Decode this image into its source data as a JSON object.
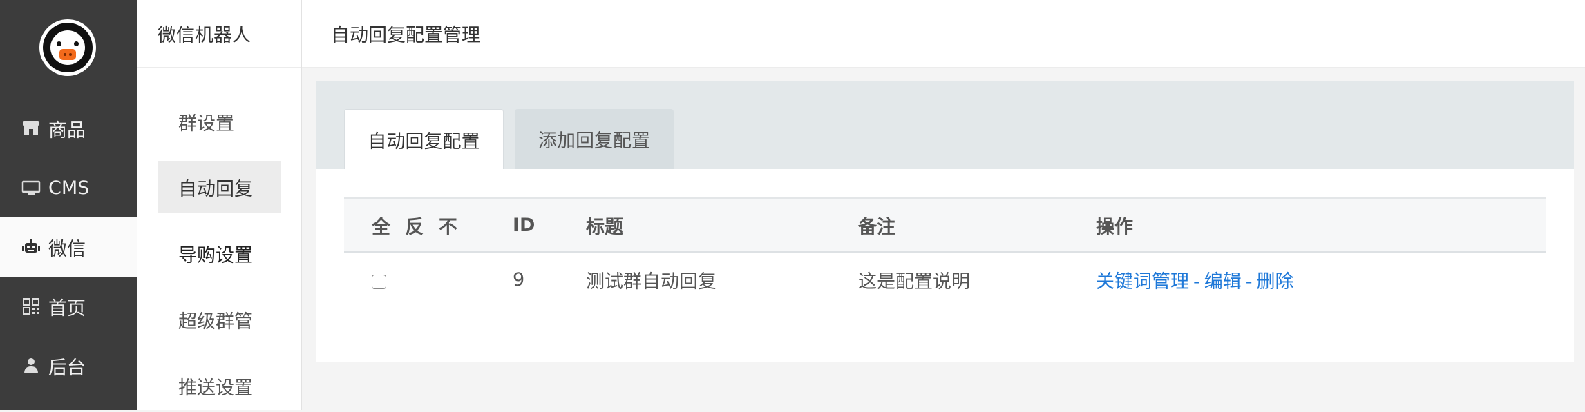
{
  "nav": {
    "items": [
      {
        "label": "商品",
        "icon": "store-icon"
      },
      {
        "label": "CMS",
        "icon": "monitor-icon"
      },
      {
        "label": "微信",
        "icon": "robot-icon"
      },
      {
        "label": "首页",
        "icon": "qrcode-icon"
      },
      {
        "label": "后台",
        "icon": "user-icon"
      }
    ],
    "active_index": 2
  },
  "subnav": {
    "title": "微信机器人",
    "items": [
      {
        "label": "群设置"
      },
      {
        "label": "自动回复"
      },
      {
        "label": "导购设置"
      },
      {
        "label": "超级群管"
      },
      {
        "label": "推送设置"
      }
    ],
    "active_index": 1
  },
  "header": {
    "title": "自动回复配置管理"
  },
  "tabs": [
    {
      "label": "自动回复配置"
    },
    {
      "label": "添加回复配置"
    }
  ],
  "table": {
    "select_all": "全",
    "select_invert": "反",
    "select_none": "不",
    "columns": [
      "ID",
      "标题",
      "备注",
      "操作"
    ],
    "rows": [
      {
        "id": "9",
        "title": "测试群自动回复",
        "note": "这是配置说明",
        "actions": {
          "keywords": "关键词管理",
          "sep1": "-",
          "edit": "编辑",
          "sep2": "-",
          "delete": "删除"
        }
      }
    ]
  },
  "colors": {
    "nav_bg": "#3c3c3c",
    "link": "#1e78d8",
    "logo_nose": "#f26a1b"
  }
}
